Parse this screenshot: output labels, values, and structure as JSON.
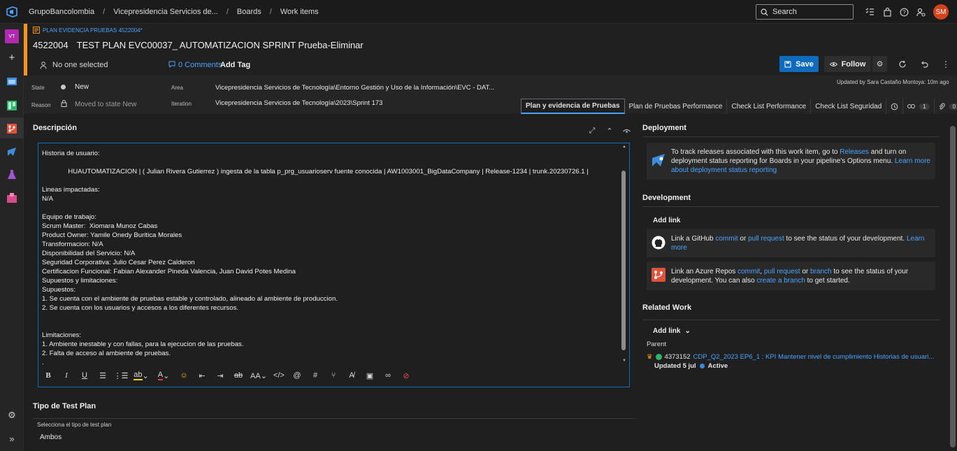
{
  "topbar": {
    "breadcrumb": [
      "GrupoBancolombia",
      "Vicepresidencia Servicios de...",
      "Boards",
      "Work items"
    ],
    "search_placeholder": "Search",
    "avatar_initials": "SM"
  },
  "rail": {
    "project_initials": "VT"
  },
  "workitem": {
    "type_label": "PLAN EVIDENCIA PRUEBAS 4522004*",
    "id": "4522004",
    "title": "TEST PLAN EVC00037_ AUTOMATIZACION SPRINT Prueba-Eliminar",
    "assigned": "No one selected",
    "comments": "0 Comments",
    "add_tag": "Add Tag",
    "save_label": "Save",
    "follow_label": "Follow",
    "updated": "Updated by Sara Castaño Montoya: 10m ago"
  },
  "fields": {
    "state_label": "State",
    "state_value": "New",
    "reason_label": "Reason",
    "reason_value": "Moved to state New",
    "area_label": "Area",
    "area_value": "Vicepresidencia Servicios de Tecnología\\Entorno Gestión y Uso de la Información\\EVC - DAT...",
    "iteration_label": "Iteration",
    "iteration_value": "Vicepresidencia Servicios de Tecnología\\2023\\Sprint 173"
  },
  "tabs": [
    "Plan y evidencia de Pruebas",
    "Plan de Pruebas Performance",
    "Check List Performance",
    "Check List Seguridad"
  ],
  "tab_counts": {
    "links": "1",
    "attachments": "0"
  },
  "description": {
    "title": "Descripción",
    "lines": [
      "Historia de usuario:",
      "",
      "              HUAUTOMATIZACION | ( Julian Rivera Gutierrez ) ingesta de la tabla p_prg_usuarioserv fuente conocida | AW1003001_BigDataCompany | Release-1234 | trunk.20230726.1 |",
      "",
      "Lineas impactadas:",
      "N/A",
      "",
      "Equipo de trabajo:",
      "Scrum Master:  Xiomara Munoz Cabas",
      "Product Owner: Yamile Onedy Buritica Morales",
      "Transformacion: N/A",
      "Disponibilidad del Servicio: N/A",
      "Seguridad Corporativa: Julio Cesar Perez Calderon",
      "Certificacion Funcional: Fabian Alexander Pineda Valencia, Juan David Potes Medina",
      "Supuestos y limitaciones:",
      "Supuestos:",
      "1. Se cuenta con el ambiente de pruebas estable y controlado, alineado al ambiente de produccion.",
      "2. Se cuenta con los usuarios y accesos a los diferentes recursos.",
      "",
      "",
      "Limitaciones:",
      "1. Ambiente inestable y con fallas, para la ejecucion de las pruebas.",
      "2. Falta de acceso al ambiente de pruebas.",
      "."
    ]
  },
  "testplan": {
    "title": "Tipo de Test Plan",
    "label": "Selecciona el tipo de test plan",
    "value": "Ambos"
  },
  "deployment": {
    "title": "Deployment",
    "text1": "To track releases associated with this work item, go to ",
    "link1": "Releases",
    "text2": " and turn on deployment status reporting for Boards in your pipeline's Options menu. ",
    "link2": "Learn more about deployment status reporting"
  },
  "development": {
    "title": "Development",
    "add_link": "Add link",
    "gh_text1": "Link a GitHub ",
    "gh_link1": "commit",
    "gh_text2": " or ",
    "gh_link2": "pull request",
    "gh_text3": " to see the status of your development. ",
    "gh_link3": "Learn more",
    "az_text1": "Link an Azure Repos ",
    "az_link1": "commit",
    "az_sep1": ", ",
    "az_link2": "pull request",
    "az_text2": " or ",
    "az_link3": "branch",
    "az_text3": " to see the status of your development. You can also ",
    "az_link4": "create a branch",
    "az_text4": " to get started."
  },
  "related": {
    "title": "Related Work",
    "add_link": "Add link",
    "parent_label": "Parent",
    "parent_id": "4373152",
    "parent_title": "CDP_Q2_2023 EP6_1 : KPI Mantener nivel de cumplimiento Historias de usuari...",
    "parent_updated": "Updated 5 jul",
    "parent_state": "Active",
    "state_color": "#3b8ad9"
  },
  "colors": {
    "accent": "#0f6cbd",
    "workitem_type": "#f7941d",
    "link": "#4aa3ff"
  }
}
